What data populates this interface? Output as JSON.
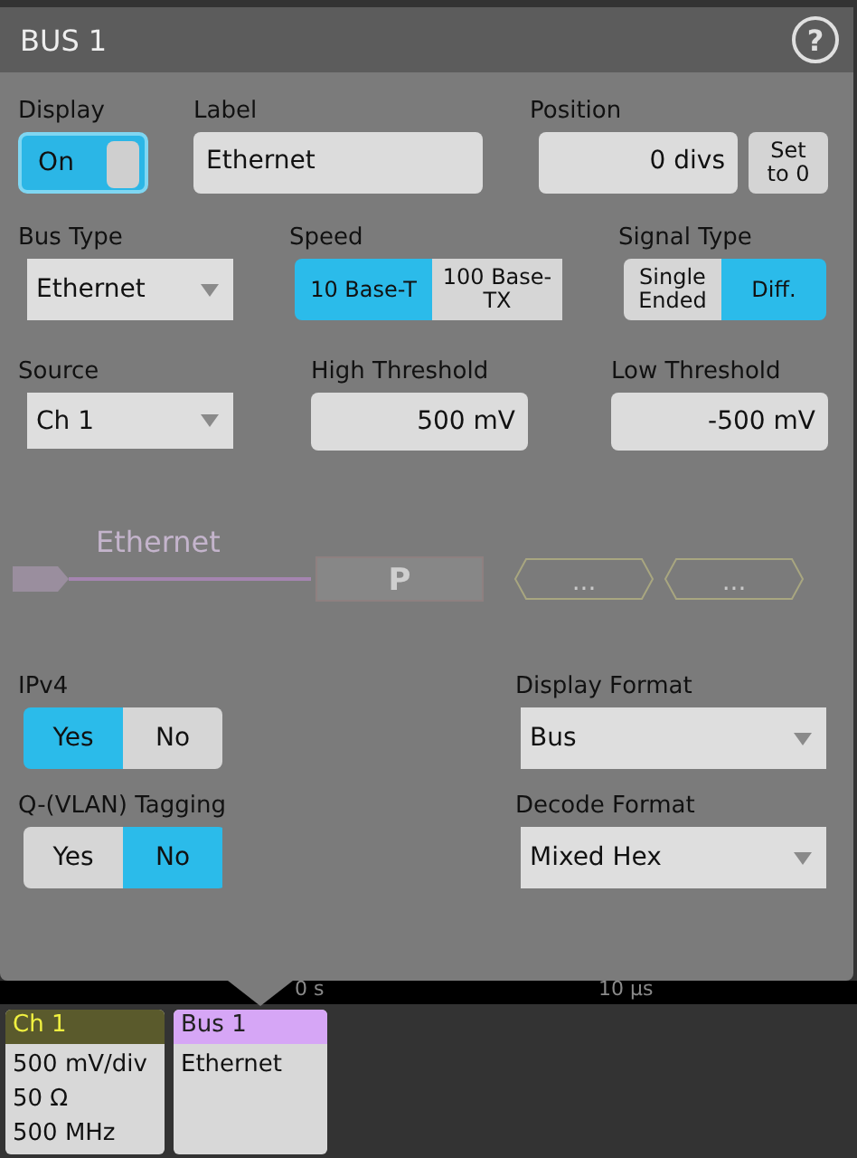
{
  "dialog": {
    "title": "BUS 1",
    "help": "?",
    "display": {
      "label": "Display",
      "toggle_text": "On",
      "on": true
    },
    "label_field": {
      "label": "Label",
      "value": "Ethernet"
    },
    "position": {
      "label": "Position",
      "value": "0 divs",
      "button": "Set to 0"
    },
    "bus_type": {
      "label": "Bus Type",
      "value": "Ethernet"
    },
    "speed": {
      "label": "Speed",
      "options": [
        {
          "label": "10 Base-T",
          "selected": true
        },
        {
          "label": "100 Base-TX",
          "selected": false
        }
      ]
    },
    "signal_type": {
      "label": "Signal Type",
      "options": [
        {
          "label": "Single Ended",
          "selected": false
        },
        {
          "label": "Diff.",
          "selected": true
        }
      ]
    },
    "source": {
      "label": "Source",
      "value": "Ch 1"
    },
    "high_threshold": {
      "label": "High Threshold",
      "value": "500 mV"
    },
    "low_threshold": {
      "label": "Low Threshold",
      "value": "-500 mV"
    },
    "waveform": {
      "label": "Ethernet",
      "packets": [
        "P",
        "...",
        "..."
      ]
    },
    "ipv4": {
      "label": "IPv4",
      "options": [
        {
          "label": "Yes",
          "selected": true
        },
        {
          "label": "No",
          "selected": false
        }
      ]
    },
    "display_format": {
      "label": "Display Format",
      "value": "Bus"
    },
    "qvlan": {
      "label": "Q-(VLAN) Tagging",
      "options": [
        {
          "label": "Yes",
          "selected": false
        },
        {
          "label": "No",
          "selected": true
        }
      ]
    },
    "decode_format": {
      "label": "Decode Format",
      "value": "Mixed Hex"
    }
  },
  "time_axis": [
    "0 s",
    "10 µs"
  ],
  "badges": [
    {
      "kind": "channel",
      "title": "Ch 1",
      "lines": [
        "500 mV/div",
        "50 Ω",
        "500 MHz"
      ]
    },
    {
      "kind": "bus",
      "title": "Bus 1",
      "lines": [
        "Ethernet"
      ]
    }
  ]
}
